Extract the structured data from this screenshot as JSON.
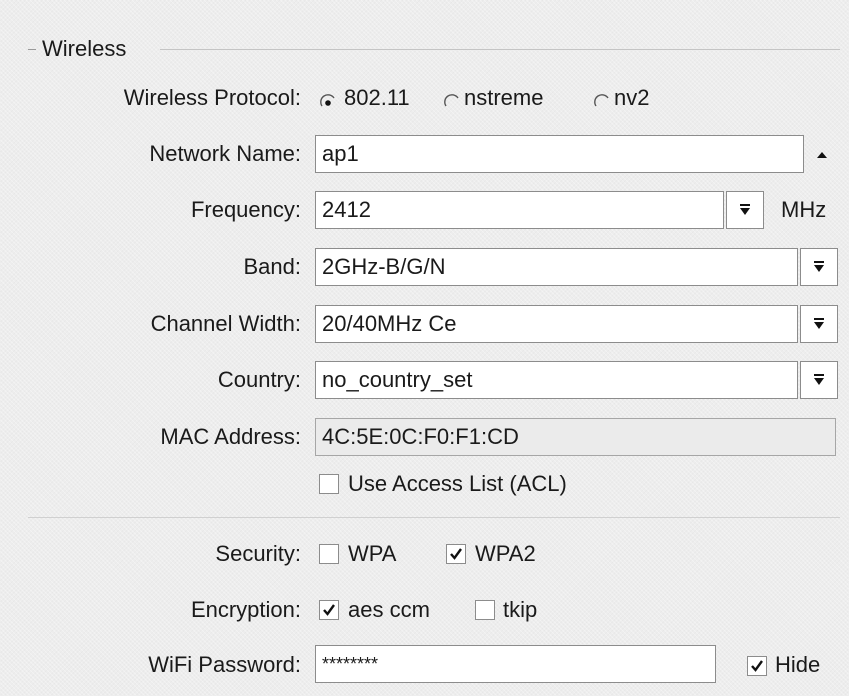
{
  "section": {
    "title": "Wireless"
  },
  "protocol": {
    "label": "Wireless Protocol:",
    "options": [
      "802.11",
      "nstreme",
      "nv2"
    ],
    "selected": "802.11"
  },
  "network_name": {
    "label": "Network Name:",
    "value": "ap1"
  },
  "frequency": {
    "label": "Frequency:",
    "value": "2412",
    "unit": "MHz"
  },
  "band": {
    "label": "Band:",
    "value": "2GHz-B/G/N"
  },
  "channel_width": {
    "label": "Channel Width:",
    "value": "20/40MHz Ce"
  },
  "country": {
    "label": "Country:",
    "value": "no_country_set"
  },
  "mac": {
    "label": "MAC Address:",
    "value": "4C:5E:0C:F0:F1:CD"
  },
  "acl": {
    "label": "Use Access List (ACL)",
    "checked": false
  },
  "security": {
    "label": "Security:",
    "wpa": {
      "label": "WPA",
      "checked": false
    },
    "wpa2": {
      "label": "WPA2",
      "checked": true
    }
  },
  "encryption": {
    "label": "Encryption:",
    "aes": {
      "label": "aes ccm",
      "checked": true
    },
    "tkip": {
      "label": "tkip",
      "checked": false
    }
  },
  "password": {
    "label": "WiFi Password:",
    "value": "********",
    "hide": {
      "label": "Hide",
      "checked": true
    }
  },
  "icons": {
    "dropdown": "chevron-down-bar-icon",
    "collapse": "triangle-up-icon",
    "radio": "radio-button-icon",
    "check": "checkmark-icon"
  },
  "colors": {
    "background": "#ededed",
    "field_border": "#8c8c8c",
    "readonly_field": "#ebebeb"
  }
}
